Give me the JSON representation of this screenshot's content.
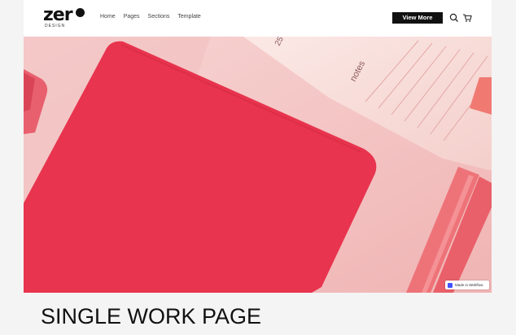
{
  "brand": {
    "wordmark": "zer",
    "sub": "DESIGN"
  },
  "nav": {
    "items": [
      "Home",
      "Pages",
      "Sections",
      "Template"
    ],
    "cta_label": "View More"
  },
  "hero": {
    "notepad_text": "notes",
    "notepad_number": "25"
  },
  "badge": {
    "label": "Made in Webflow"
  },
  "page_title": "SINGLE WORK PAGE",
  "colors": {
    "accent": "#e8344e",
    "nav_button": "#111111",
    "badge_logo": "#4353ff"
  }
}
